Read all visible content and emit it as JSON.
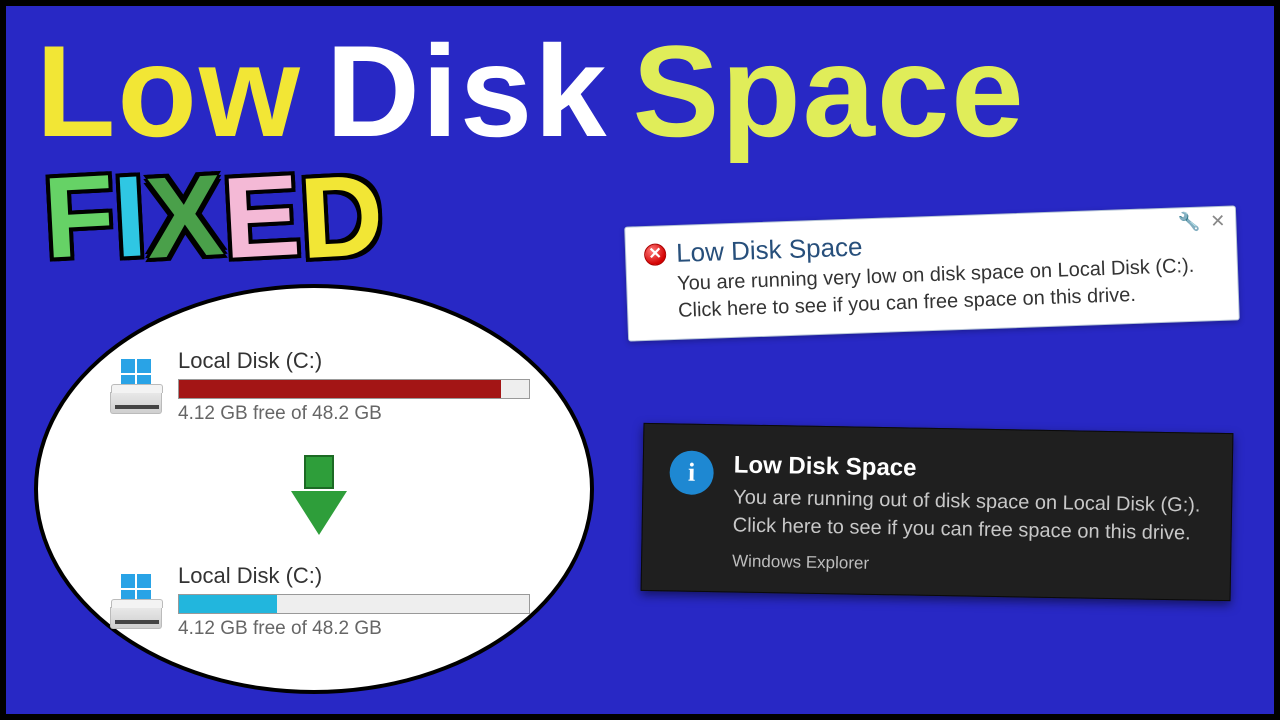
{
  "title": {
    "w1": "Low",
    "w2": "Disk",
    "w3": "Space"
  },
  "fixed": {
    "c1": "F",
    "c2": "I",
    "c3": "X",
    "c4": "E",
    "c5": "D"
  },
  "oval": {
    "before": {
      "label": "Local Disk (C:)",
      "subtitle": "4.12 GB free of 48.2 GB",
      "fill_percent": 92,
      "bar_color": "#a31515"
    },
    "after": {
      "label": "Local Disk (C:)",
      "subtitle": "4.12 GB free of 48.2 GB",
      "fill_percent": 28,
      "bar_color": "#22b6dd"
    }
  },
  "notif_light": {
    "title": "Low Disk Space",
    "body_line1": "You are running very low on disk space on Local Disk (C:).",
    "body_line2": "Click here to see if you can free space on this drive."
  },
  "notif_dark": {
    "title": "Low Disk Space",
    "body_line1": "You are running out of disk space on Local Disk (G:).",
    "body_line2": "Click here to see if you can free space on this drive.",
    "source": "Windows Explorer"
  }
}
